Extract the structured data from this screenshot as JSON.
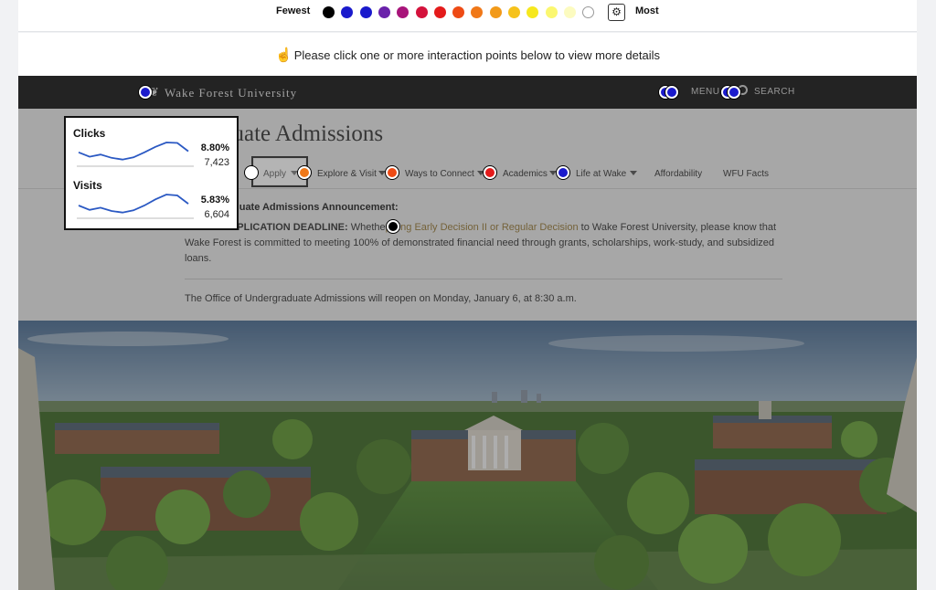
{
  "legend": {
    "fewest_label": "Fewest",
    "most_label": "Most",
    "colors": [
      "#000000",
      "#1a1acc",
      "#1a1acc",
      "#6a22aa",
      "#a8147a",
      "#d4123c",
      "#e41b1b",
      "#ee4b15",
      "#f07818",
      "#f29a1a",
      "#f6c21b",
      "#f6e81e",
      "#fbf770",
      "#fcfbc0",
      "#ffffff"
    ],
    "settings_icon": "gear-icon"
  },
  "instruction": {
    "text": "Please click one or more interaction points below to view more details",
    "icon": "pointer-hand-icon"
  },
  "site": {
    "logo": "Wake Forest University",
    "menu_label": "MENU",
    "search_label": "SEARCH",
    "page_title": "Undergraduate Admissions",
    "visible_title": "duate Admissions",
    "nav": [
      "Apply",
      "Explore & Visit",
      "Ways to Connect",
      "Academics",
      "Life at Wake",
      "Affordability",
      "WFU Facts"
    ],
    "announcement_title": "Undergraduate Admissions Announcement:",
    "announcement_visible_title": "duate Admissions Announcement:",
    "deadline_label": "APPLICATION DEADLINE:",
    "deadline_text_1": "Whethe",
    "deadline_link": "plying Early Decision II or Regular Decision",
    "deadline_text_2": " to Wake Forest University, please know that Wake Forest is committed to meeting 100% of demonstrated financial need through grants, scholarships, work-study, and subsidized loans.",
    "reopen_text": "The Office of Undergraduate Admissions will reopen on Monday, January 6, at 8:30 a.m."
  },
  "popup": {
    "clicks_label": "Clicks",
    "clicks_pct": "8.80%",
    "clicks_count": "7,423",
    "visits_label": "Visits",
    "visits_pct": "5.83%",
    "visits_count": "6,604",
    "clicks_trend": [
      0.55,
      0.35,
      0.45,
      0.3,
      0.22,
      0.32,
      0.55,
      0.8,
      1.0,
      0.98,
      0.6
    ],
    "visits_trend": [
      0.5,
      0.3,
      0.4,
      0.25,
      0.18,
      0.28,
      0.5,
      0.78,
      1.0,
      0.96,
      0.58
    ]
  }
}
